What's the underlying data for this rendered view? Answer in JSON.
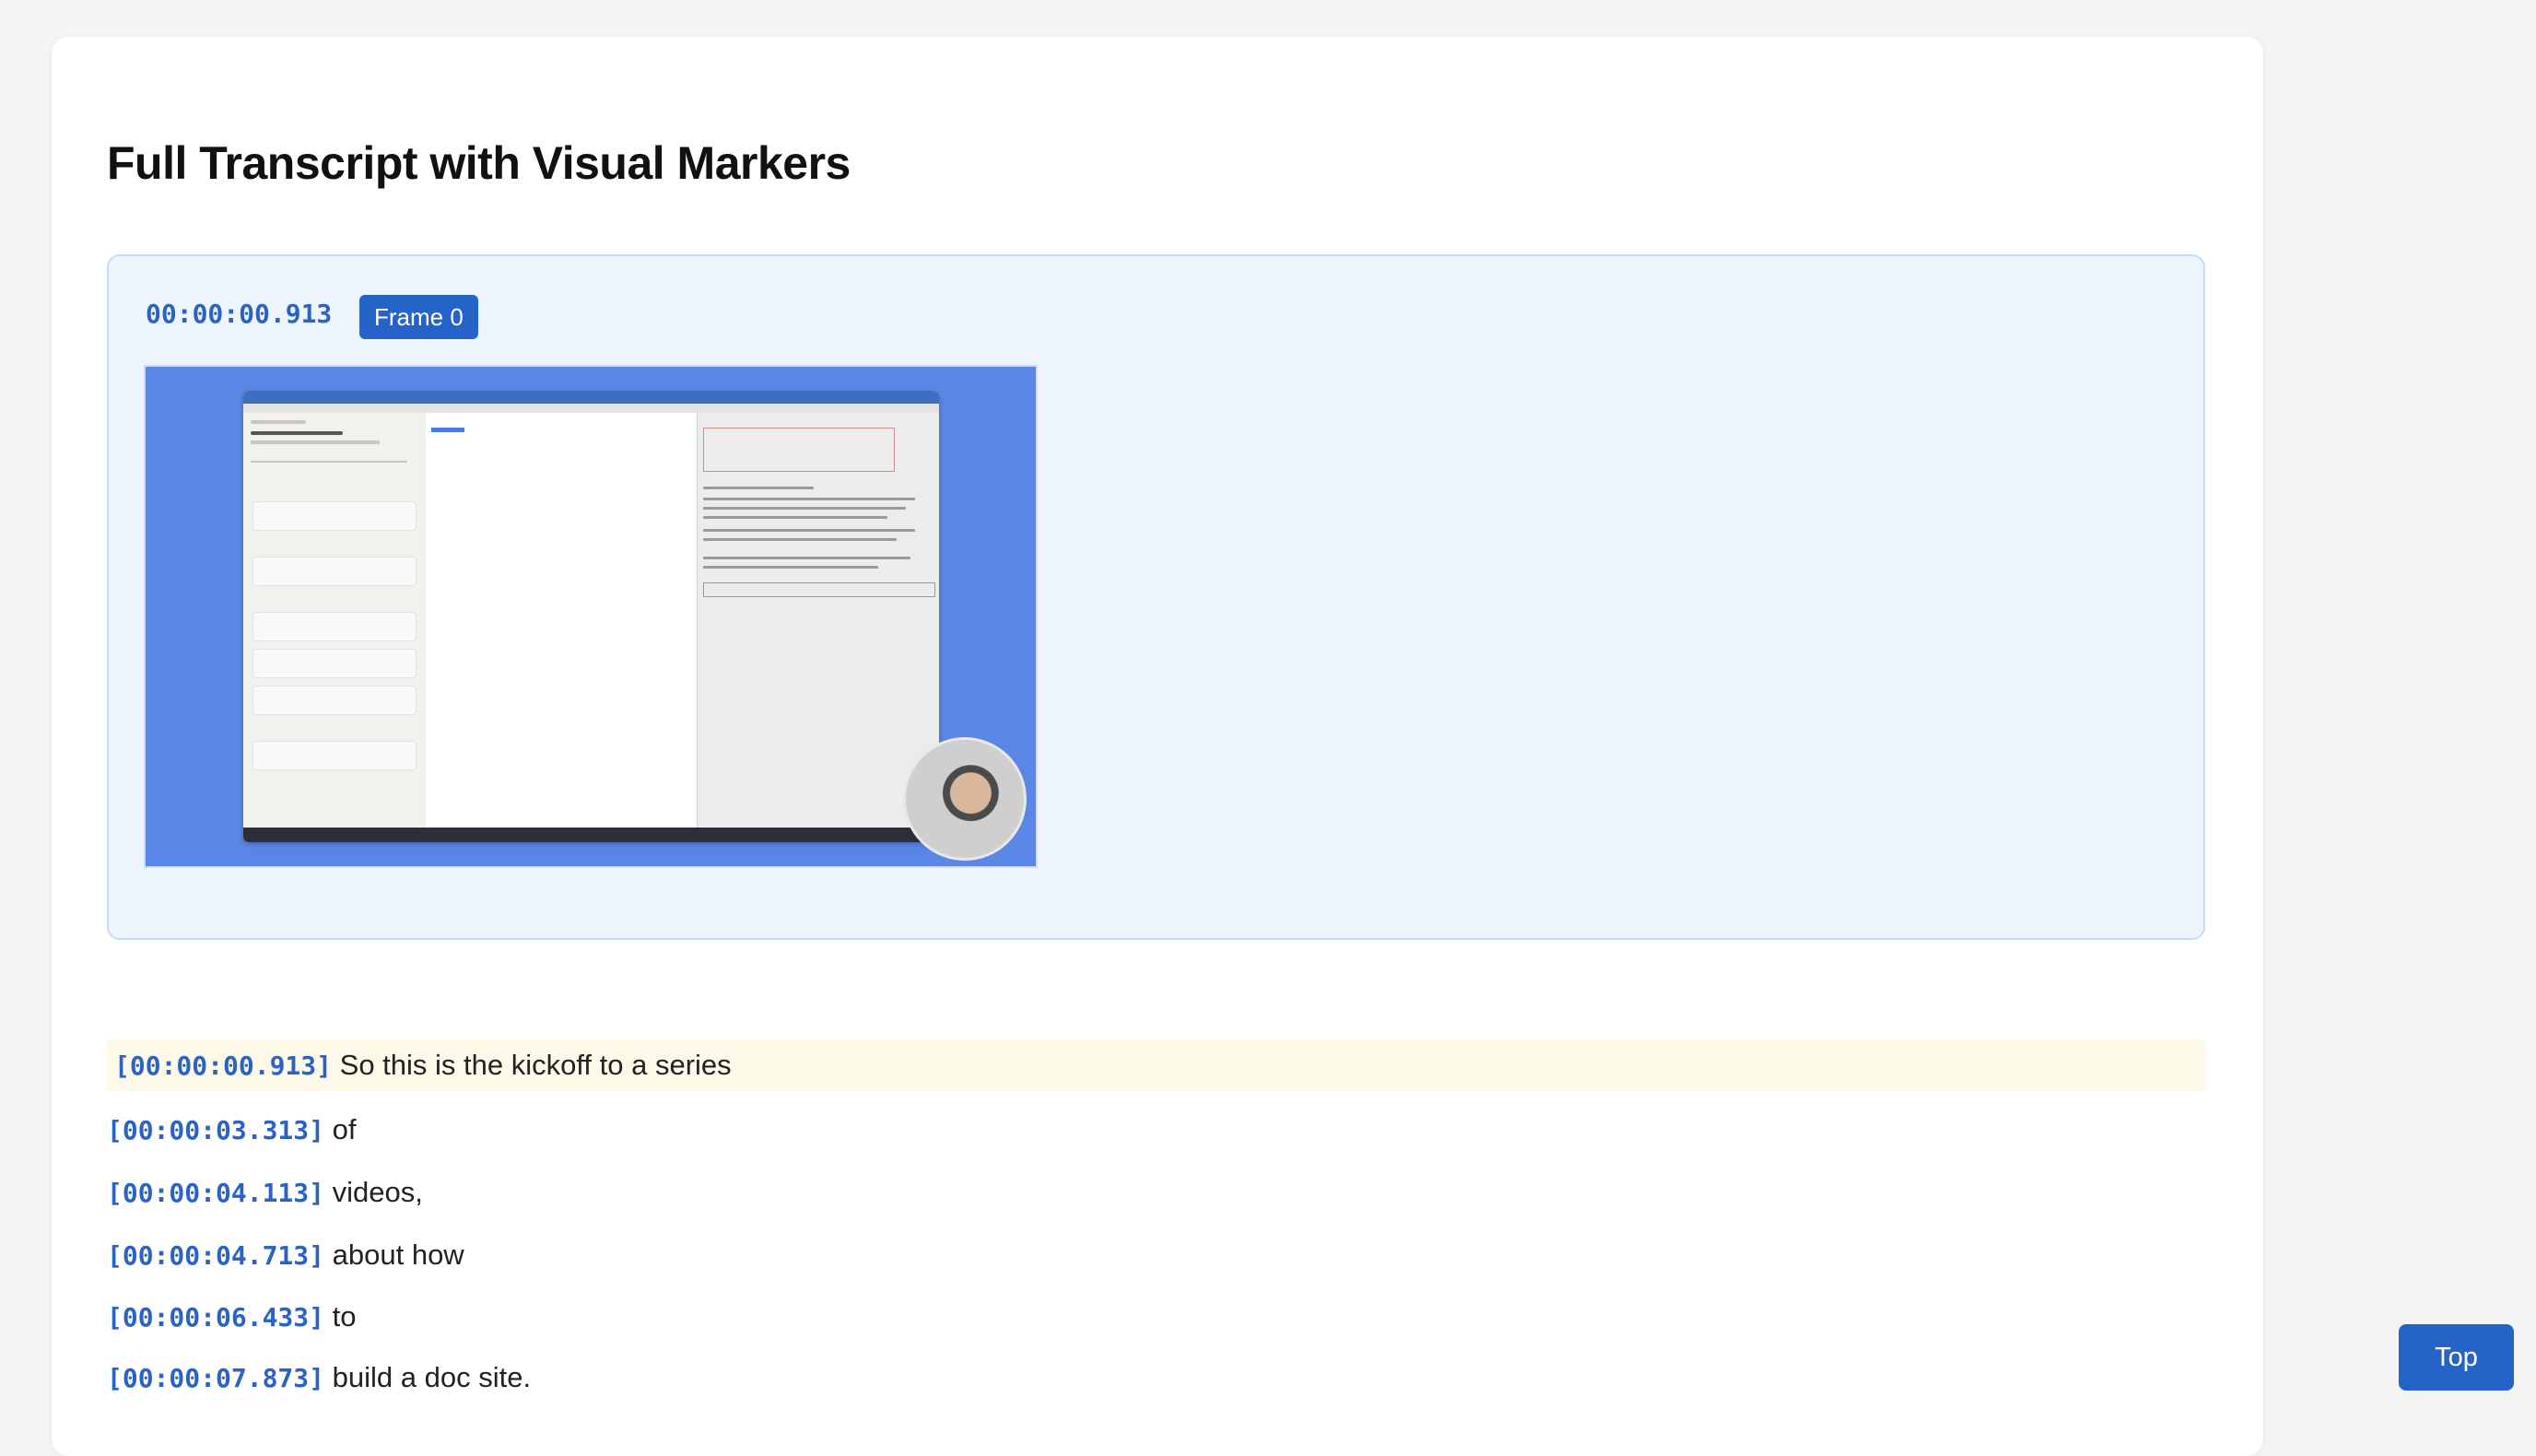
{
  "page_title": "Full Transcript with Visual Markers",
  "frame": {
    "timestamp": "00:00:00.913",
    "badge": "Frame 0"
  },
  "transcript": [
    {
      "timestamp": "[00:00:00.913]",
      "text": "So this is the kickoff to a series",
      "active": true
    },
    {
      "timestamp": "[00:00:03.313]",
      "text": "of"
    },
    {
      "timestamp": "[00:00:04.113]",
      "text": "videos,"
    },
    {
      "timestamp": "[00:00:04.713]",
      "text": "about how"
    },
    {
      "timestamp": "[00:00:06.433]",
      "text": "to"
    },
    {
      "timestamp": "[00:00:07.873]",
      "text": "build a doc site."
    }
  ],
  "top_button": "Top",
  "colors": {
    "accent": "#2563c9",
    "timestamp": "#2a63c4",
    "frame_bg": "#eef5ff",
    "active_line_bg": "#fdf9e9"
  }
}
